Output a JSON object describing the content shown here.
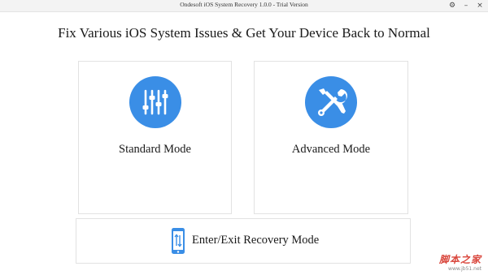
{
  "window": {
    "title": "Ondesoft iOS System Recovery 1.0.0 - Trial Version",
    "controls": [
      {
        "name": "settings-icon",
        "glyph": "⚙"
      },
      {
        "name": "minimize-button",
        "glyph": "–"
      },
      {
        "name": "close-button",
        "glyph": "×"
      }
    ]
  },
  "main": {
    "headline": "Fix Various iOS System Issues & Get Your Device Back to Normal",
    "modes": [
      {
        "label": "Standard Mode",
        "icon": "sliders-icon"
      },
      {
        "label": "Advanced Mode",
        "icon": "wrench-screwdriver-icon"
      }
    ],
    "recovery": {
      "label": "Enter/Exit Recovery Mode",
      "icon": "phone-transfer-icon"
    }
  },
  "watermark": {
    "main": "脚本之家",
    "sub": "www.jb51.net"
  },
  "colors": {
    "accent": "#3a8ee6",
    "card_border": "#e2e2e2",
    "titlebar": "#f3f3f3"
  }
}
